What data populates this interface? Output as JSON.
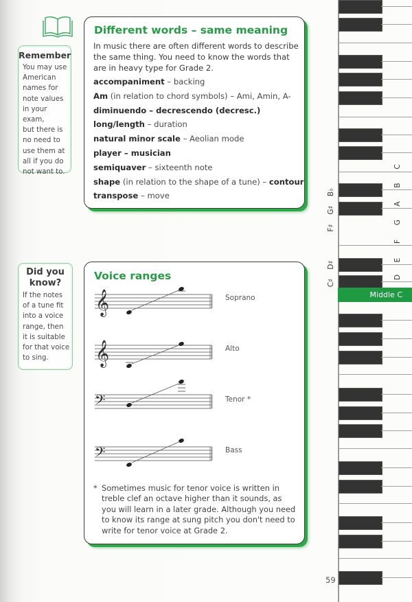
{
  "remember": {
    "icon": "book-icon",
    "title": "Remember",
    "text": "You may use\nAmerican\nnames for\nnote values\nin your exam,\nbut there is\nno need to\nuse them at\nall if you do\nnot want to."
  },
  "did_you_know": {
    "title_line1": "Did you",
    "title_line2": "know?",
    "text": "If the notes\nof a tune fit\ninto a voice\nrange, then\nit is suitable\nfor that voice\nto sing."
  },
  "words_card": {
    "title": "Different words – same meaning",
    "intro": "In music there are often different words to describe the same thing. You need to know the words that are in heavy type for Grade 2.",
    "terms": [
      {
        "bold": "accompaniment",
        "rest": " – backing",
        "bold2": ""
      },
      {
        "bold": "Am",
        "rest": " (in relation to chord symbols) – Ami, Amin, A-",
        "bold2": ""
      },
      {
        "bold": "diminuendo – decrescendo (decresc.)",
        "rest": "",
        "bold2": ""
      },
      {
        "bold": "long/length",
        "rest": " – duration",
        "bold2": ""
      },
      {
        "bold": "natural minor scale",
        "rest": " – Aeolian mode",
        "bold2": ""
      },
      {
        "bold": "player – musician",
        "rest": "",
        "bold2": ""
      },
      {
        "bold": "semiquaver",
        "rest": " – sixteenth note",
        "bold2": ""
      },
      {
        "bold": "shape",
        "rest": " (in relation to the shape of a tune) – ",
        "bold2": "contour"
      },
      {
        "bold": "transpose",
        "rest": " – move",
        "bold2": ""
      }
    ]
  },
  "voice_card": {
    "title": "Voice ranges",
    "voices": [
      {
        "name": "Soprano",
        "clef": "treble"
      },
      {
        "name": "Alto",
        "clef": "treble"
      },
      {
        "name": "Tenor *",
        "clef": "bass"
      },
      {
        "name": "Bass",
        "clef": "bass"
      }
    ],
    "footnote_star": "*",
    "footnote": "Sometimes music for tenor voice is written in treble clef an octave higher than it sounds, as you will learn in a later grade. Although you need to know its range at sung pitch you don't need to write for tenor voice at Grade 2."
  },
  "keyboard": {
    "white_key_labels": [
      "C",
      "B",
      "A",
      "G",
      "F",
      "E",
      "D"
    ],
    "black_key_labels": [
      "B♭",
      "G♯",
      "F♯",
      "D♯",
      "C♯"
    ],
    "middle_c_label": "Middle C",
    "accent_color": "#1f9a43"
  },
  "page_number": "59"
}
